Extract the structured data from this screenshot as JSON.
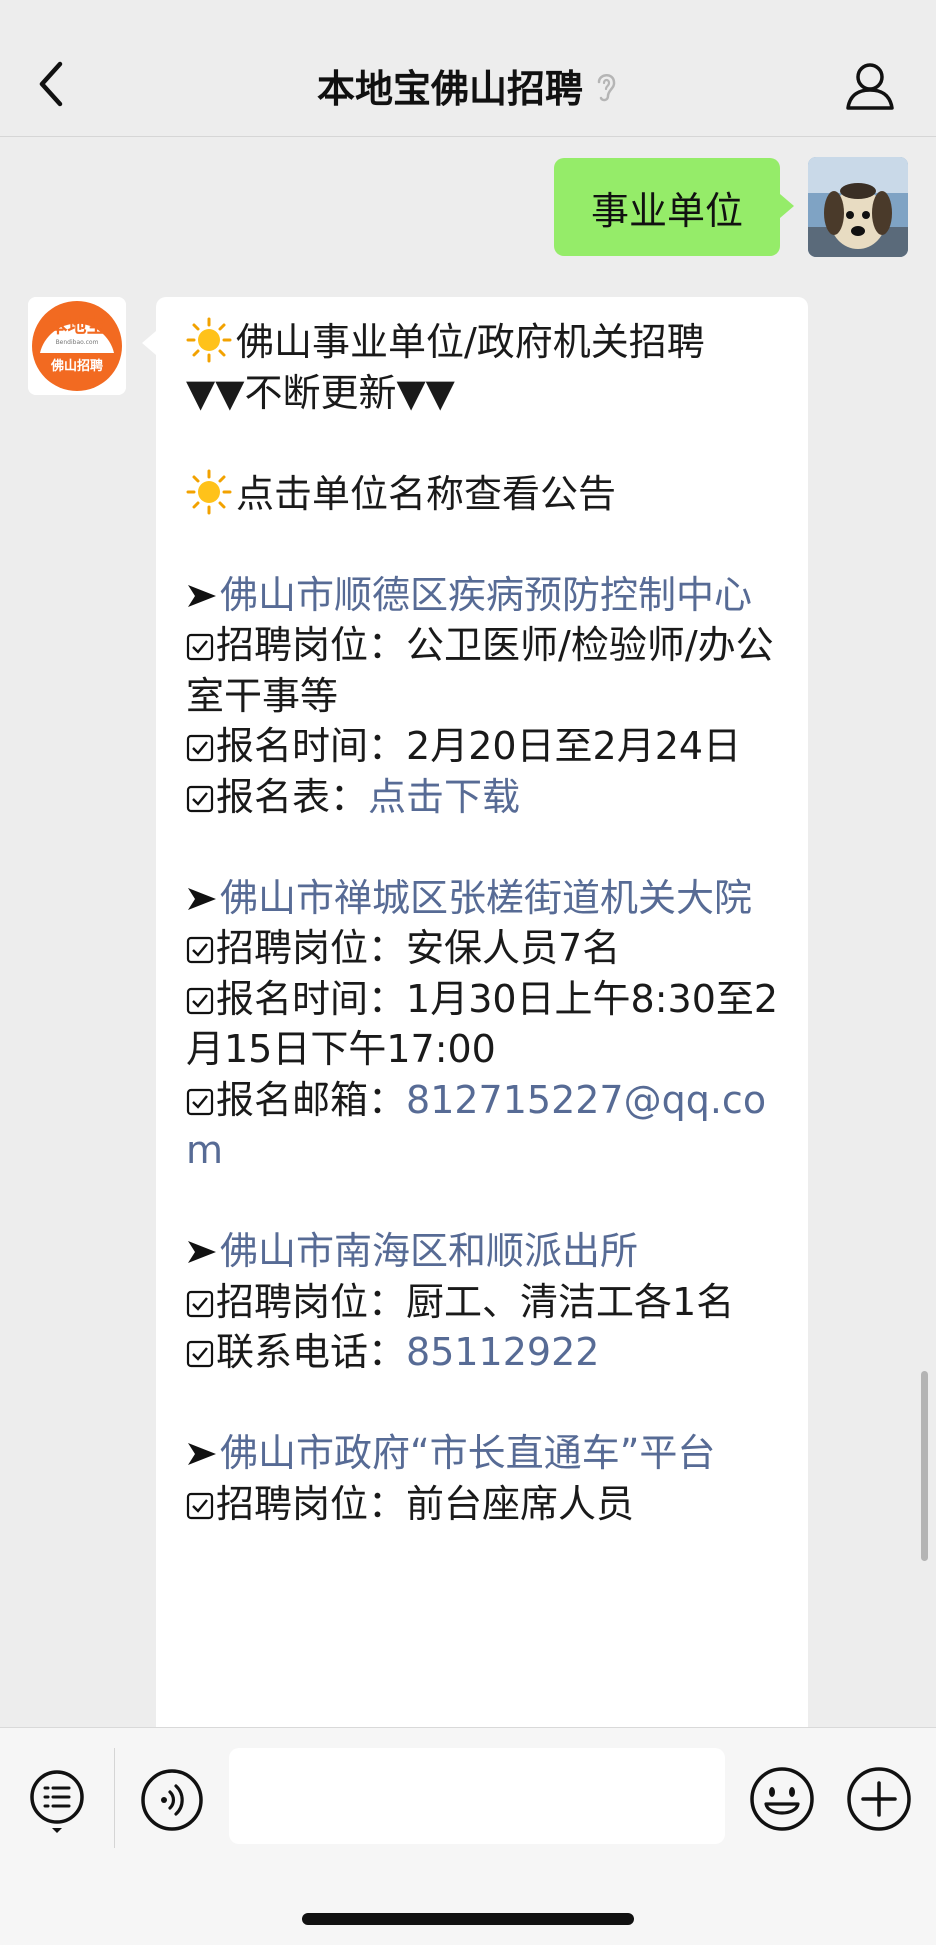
{
  "header": {
    "title": "本地宝佛山招聘"
  },
  "conversation": {
    "sent_message": "事业单位",
    "bot_logo": {
      "top_text": "本地宝",
      "url_text": "Bendibao.com",
      "bottom_text": "佛山招聘"
    },
    "intro": {
      "line1": "佛山事业单位/政府机关招聘",
      "line2": "▼▼不断更新▼▼",
      "hint": "点击单位名称查看公告"
    },
    "jobs": [
      {
        "name": "佛山市顺德区疾病预防控制中心",
        "position_label": "招聘岗位：",
        "position_value": "公卫医师/检验师/办公室干事等",
        "time_label": "报名时间：",
        "time_value": "2月20日至2月24日",
        "extra_label": "报名表：",
        "extra_value": "点击下载"
      },
      {
        "name": "佛山市禅城区张槎街道机关大院",
        "position_label": "招聘岗位：",
        "position_value": "安保人员7名",
        "time_label": "报名时间：",
        "time_value": "1月30日上午8:30至2月15日下午17:00",
        "extra_label": "报名邮箱：",
        "extra_value": "812715227@qq.com"
      },
      {
        "name": "佛山市南海区和顺派出所",
        "position_label": "招聘岗位：",
        "position_value": "厨工、清洁工各1名",
        "extra_label": "联系电话：",
        "extra_value": "85112922"
      },
      {
        "name": "佛山市政府“市长直通车”平台",
        "position_label": "招聘岗位：",
        "position_value": "前台座席人员"
      }
    ]
  },
  "input_bar": {
    "placeholder": ""
  },
  "colors": {
    "sent_bubble": "#95ec69",
    "link": "#576b95",
    "background": "#ededed",
    "logo_orange": "#f26a21"
  },
  "icons": [
    "back-icon",
    "ear-icon",
    "profile-icon",
    "sun-icon",
    "checkbox-icon",
    "arrow-icon",
    "menu-icon",
    "voice-icon",
    "emoji-icon",
    "plus-icon"
  ]
}
